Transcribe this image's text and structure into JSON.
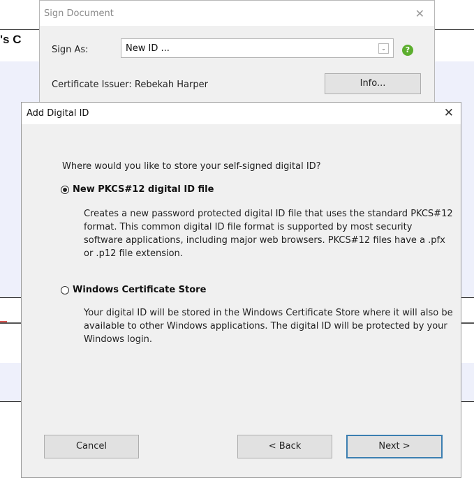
{
  "background_document": {
    "title_fragment": "'s C"
  },
  "sign_dialog": {
    "title": "Sign Document",
    "close_glyph": "✕",
    "sign_as_label": "Sign As:",
    "sign_as_value": "New ID ...",
    "dropdown_glyph": "⌄",
    "help_glyph": "?",
    "certificate_issuer": "Certificate Issuer: Rebekah Harper",
    "info_button": "Info..."
  },
  "add_dialog": {
    "title": "Add Digital ID",
    "close_glyph": "✕",
    "question": "Where would you like to store your self-signed digital ID?",
    "options": [
      {
        "label": "New PKCS#12 digital ID file",
        "selected": true,
        "description": "Creates a new password protected digital ID file that uses the standard PKCS#12 format. This common digital ID file format is supported by most security software applications, including major web browsers. PKCS#12 files have a .pfx or .p12 file extension."
      },
      {
        "label": "Windows Certificate Store",
        "selected": false,
        "description": "Your digital ID will be stored in the Windows Certificate Store where it will also be available to other Windows applications. The digital ID will be protected by your Windows login."
      }
    ],
    "buttons": {
      "cancel": "Cancel",
      "back": "< Back",
      "next": "Next >"
    }
  },
  "colors": {
    "help_icon": "#5cae2e",
    "default_button_border": "#3c7fb1",
    "document_band": "#eef0fb"
  }
}
